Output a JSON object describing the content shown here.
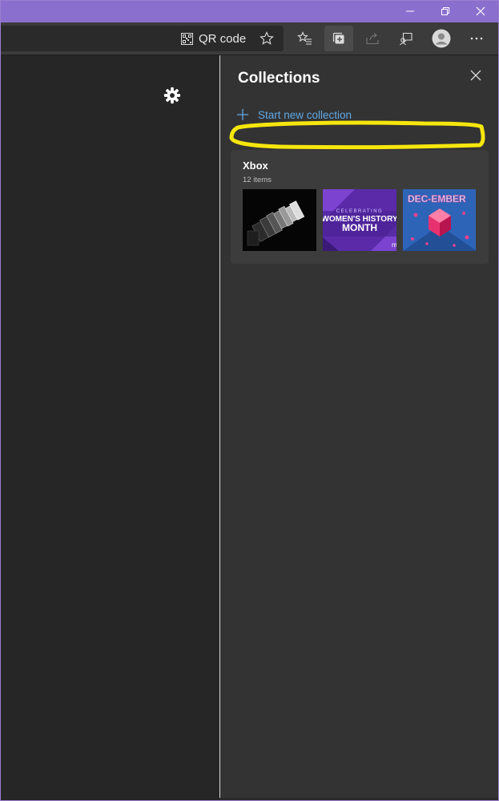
{
  "window": {
    "title_bar_color": "#8b6fce"
  },
  "toolbar": {
    "qr_code_label": "QR code",
    "icons": [
      "qr-code-icon",
      "star-icon",
      "favorites-icon",
      "collections-icon",
      "share-icon",
      "feedback-icon",
      "profile-icon",
      "more-icon"
    ]
  },
  "settings": {
    "icon": "gear-icon"
  },
  "collections_panel": {
    "title": "Collections",
    "start_new_label": "Start new collection",
    "highlight_color": "#f5e60d",
    "accent_color": "#5fa8e6"
  },
  "collections": [
    {
      "name": "Xbox",
      "count_label": "12 items",
      "thumbnails": [
        {
          "alt": "xbox-series-x-exploded-view-thumbnail",
          "text": ""
        },
        {
          "alt": "womens-history-month-thumbnail",
          "text_top": "CELEBRATING",
          "text_mid": "WOMEN'S HISTORY",
          "text_bottom": "MONTH"
        },
        {
          "alt": "dec-ember-thumbnail",
          "text": "DEC-EMBER"
        }
      ]
    }
  ]
}
